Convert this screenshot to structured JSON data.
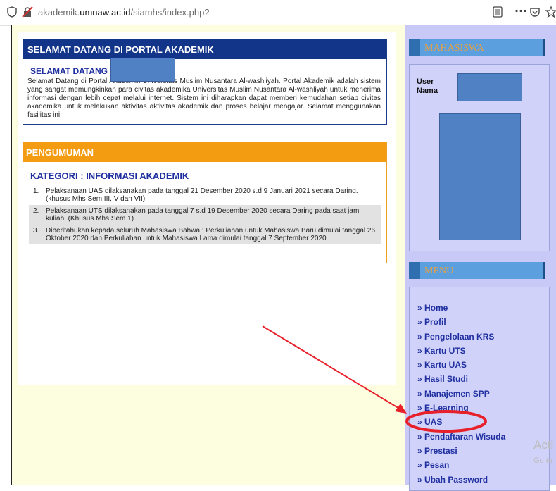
{
  "browser": {
    "url_prefix": "akademik.",
    "url_domain": "umnaw.ac.id",
    "url_path": "/siamhs/index.php?",
    "toolbar_more": "···"
  },
  "welcome": {
    "title": "SELAMAT DATANG DI PORTAL AKADEMIK",
    "heading": "SELAMAT DATANG",
    "body": "Selamat Datang di Portal Akademik Universitas Muslim Nusantara Al-washliyah. Portal Akademik adalah sistem yang sangat memungkinkan para civitas akademika Universitas Muslim Nusantara Al-washliyah untuk menerima informasi dengan lebih cepat melalui internet. Sistem ini diharapkan dapat memberi kemudahan setiap civitas akademika untuk melakukan aktivitas aktivitas akademik dan proses belajar mengajar. Selamat menggunakan fasilitas ini."
  },
  "news": {
    "title": "PENGUMUMAN",
    "category": "KATEGORI : INFORMASI AKADEMIK",
    "items": [
      {
        "num": "1.",
        "text": "Pelaksanaan UAS dilaksanakan pada tanggal 21 Desember 2020 s.d 9 Januari 2021 secara Daring. (khusus Mhs Sem III, V dan VII)"
      },
      {
        "num": "2.",
        "text": "Pelaksanaan UTS dilaksanakan pada tanggal 7 s.d 19 Desember 2020 secara Daring pada saat jam kuliah. (Khusus Mhs Sem 1)"
      },
      {
        "num": "3.",
        "text": "Diberitahukan kepada seluruh Mahasiswa Bahwa : Perkuliahan untuk Mahasiswa Baru dimulai tanggal 26 Oktober 2020 dan Perkuliahan untuk Mahasiswa Lama dimulai tanggal 7 September 2020"
      }
    ]
  },
  "sidebar": {
    "student_header": "MAHASISWA",
    "user_label": "User",
    "name_label": "Nama",
    "menu_header": "MENU",
    "menu": [
      "» Home",
      "» Profil",
      "» Pengelolaan KRS",
      "» Kartu UTS",
      "» Kartu UAS",
      "» Hasil Studi",
      "» Manajemen SPP",
      "» E-Learning",
      "» UAS",
      "» Pendaftaran Wisuda",
      "» Prestasi",
      "» Pesan",
      "» Ubah Password"
    ]
  },
  "watermark": {
    "line1": "Acti",
    "line2": "Go to"
  },
  "colors": {
    "annotation_red": "#e8202a",
    "redaction_blue": "#4f81c4",
    "welcome_header": "#12358a",
    "news_header": "#f39c12",
    "sidebar_bg": "#c9c9f7"
  }
}
